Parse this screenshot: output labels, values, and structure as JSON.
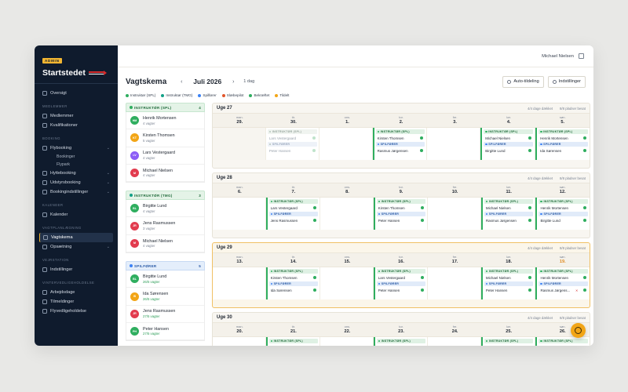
{
  "sidebar": {
    "badge": "ADMIN",
    "brand": "Startstedet",
    "top_item": "Oversigt",
    "sections": [
      {
        "title": "MEDLEMMER",
        "items": [
          "Medlemmer",
          "Kvalifikationer"
        ]
      },
      {
        "title": "BOOKING",
        "items": [
          "Flybooking",
          "Bookinger",
          "Flypark",
          "Hyttebooking",
          "Udstyrsbooking",
          "Bookingindstillinger"
        ]
      },
      {
        "title": "KALENDER",
        "items": [
          "Kalender"
        ]
      },
      {
        "title": "VAGTPLANLÆGNING",
        "items": [
          "Vagtskema",
          "Opsætning"
        ]
      },
      {
        "title": "VEJRSTATION",
        "items": [
          "Indstillinger"
        ]
      },
      {
        "title": "VINTERVEDLIGEHOLDELSE",
        "items": [
          "Arbejdsdage",
          "Tilmeldinger",
          "Flyvedligeholdelse"
        ]
      }
    ]
  },
  "header": {
    "user": "Michael Nielsen"
  },
  "toolbar": {
    "title": "Vagtskema",
    "prev": "‹",
    "month": "Juli 2026",
    "next": "›",
    "day_view": "1 dag",
    "auto_btn": "Auto-tildeling",
    "settings_btn": "Indstillinger"
  },
  "legend": [
    {
      "label": "Instruktør (SPL)",
      "color": "#2fae5f"
    },
    {
      "label": "Instruktør (TMG)",
      "color": "#12a087"
    },
    {
      "label": "Spilfører",
      "color": "#3b82f6"
    },
    {
      "label": "Slæbepilot",
      "color": "#e2562b"
    },
    {
      "label": "Bekræftet",
      "color": "#2fae5f"
    },
    {
      "label": "Tildelt",
      "color": "#f2a516"
    }
  ],
  "roster": [
    {
      "title": "INSTRUKTØR (SPL)",
      "count": "4",
      "style": "g",
      "people": [
        {
          "init": "HM",
          "name": "Henrik Mortensen",
          "sub": "4 vagter",
          "c": "#2fae5f",
          "ok": false
        },
        {
          "init": "KT",
          "name": "Kirsten Thomsen",
          "sub": "5 vagter",
          "c": "#f2a516",
          "ok": false
        },
        {
          "init": "LV",
          "name": "Lars Vestergaard",
          "sub": "4 vagter",
          "c": "#8b5cf6",
          "ok": false
        },
        {
          "init": "M",
          "name": "Michael Nielsen",
          "sub": "4 vagter",
          "c": "#e23b4e",
          "ok": false
        }
      ]
    },
    {
      "title": "INSTRUKTØR (TMG)",
      "count": "3",
      "style": "t",
      "people": [
        {
          "init": "BL",
          "name": "Birgitte Lund",
          "sub": "4 vagter",
          "c": "#2fae5f",
          "ok": false
        },
        {
          "init": "JR",
          "name": "Jens Rasmussen",
          "sub": "3 vagter",
          "c": "#e23b4e",
          "ok": false
        },
        {
          "init": "M",
          "name": "Michael Nielsen",
          "sub": "4 vagter",
          "c": "#e23b4e",
          "ok": false
        }
      ]
    },
    {
      "title": "SPILFØRER",
      "count": "5",
      "style": "b",
      "people": [
        {
          "init": "BL",
          "name": "Birgitte Lund",
          "sub": "26/5 vagter",
          "c": "#2fae5f",
          "ok": true
        },
        {
          "init": "IS",
          "name": "Ida Sørensen",
          "sub": "26/5 vagter",
          "c": "#f2a516",
          "ok": true
        },
        {
          "init": "JR",
          "name": "Jens Rasmussen",
          "sub": "27/5 vagter",
          "c": "#e23b4e",
          "ok": true
        },
        {
          "init": "PH",
          "name": "Peter Hansen",
          "sub": "27/5 vagter",
          "c": "#2fae5f",
          "ok": true
        }
      ]
    }
  ],
  "weeks": [
    {
      "title": "Uge 27",
      "covered": "4/4 dage dækket",
      "filled": "8/8 pladser besat",
      "cur": false,
      "days": [
        [
          "man.",
          "29."
        ],
        [
          "tir.",
          "30."
        ],
        [
          "ons.",
          "1."
        ],
        [
          "tor.",
          "2."
        ],
        [
          "fre.",
          "3."
        ],
        [
          "lør.",
          "4."
        ],
        [
          "søn.",
          "5."
        ]
      ],
      "cells": [
        null,
        {
          "ghost": true,
          "a": "Lars Vestergaard",
          "b": "Peter Hansen"
        },
        null,
        {
          "a": "Kirsten Thomsen",
          "b": "Rasmus Jørgensen"
        },
        null,
        {
          "a": "Michael Nielsen",
          "b": "Birgitte Lund"
        },
        {
          "a": "Henrik Mortensen",
          "b": "Ida Sørensen"
        }
      ]
    },
    {
      "title": "Uge 28",
      "covered": "4/4 dage dækket",
      "filled": "8/8 pladser besat",
      "cur": false,
      "days": [
        [
          "man.",
          "6."
        ],
        [
          "tir.",
          "7."
        ],
        [
          "ons.",
          "8."
        ],
        [
          "tor.",
          "9."
        ],
        [
          "fre.",
          "10."
        ],
        [
          "lør.",
          "11."
        ],
        [
          "søn.",
          "12."
        ]
      ],
      "cells": [
        null,
        {
          "a": "Lars Vestergaard",
          "b": "Jens Rasmussen"
        },
        null,
        {
          "a": "Kirsten Thomsen",
          "b": "Peter Hansen"
        },
        null,
        {
          "a": "Michael Nielsen",
          "b": "Rasmus Jørgensen"
        },
        {
          "a": "Henrik Mortensen",
          "b": "Birgitte Lund"
        }
      ]
    },
    {
      "title": "Uge 29",
      "covered": "4/4 dage dækket",
      "filled": "8/8 pladser besat",
      "cur": true,
      "days": [
        [
          "man.",
          "13."
        ],
        [
          "tir.",
          "14."
        ],
        [
          "ons.",
          "15."
        ],
        [
          "tor.",
          "16."
        ],
        [
          "fre.",
          "17."
        ],
        [
          "lør.",
          "18."
        ],
        [
          "søn.",
          "19."
        ]
      ],
      "cells": [
        null,
        {
          "a": "Kirsten Thomsen",
          "b": "Ida Sørensen"
        },
        null,
        {
          "a": "Lars Vestergaard",
          "b": "Peter Hansen"
        },
        null,
        {
          "a": "Michael Nielsen",
          "b": "Peter Hansen"
        },
        {
          "a": "Henrik Mortensen",
          "b": "Rasmus Jørgens...",
          "warn": true
        }
      ]
    },
    {
      "title": "Uge 30",
      "covered": "4/4 dage dækket",
      "filled": "8/8 pladser besat",
      "cur": false,
      "days": [
        [
          "man.",
          "20."
        ],
        [
          "tir.",
          "21."
        ],
        [
          "ons.",
          "22."
        ],
        [
          "tor.",
          "23."
        ],
        [
          "fre.",
          "24."
        ],
        [
          "lør.",
          "25."
        ],
        [
          "søn.",
          "26."
        ]
      ],
      "cells": [
        null,
        {
          "a": "",
          "b": ""
        },
        null,
        {
          "a": "",
          "b": ""
        },
        null,
        {
          "a": "",
          "b": ""
        },
        {
          "a": "",
          "b": ""
        }
      ]
    }
  ],
  "labels": {
    "spl": "INSTRUKTØR (SPL)",
    "spf": "SPILFØRER"
  }
}
